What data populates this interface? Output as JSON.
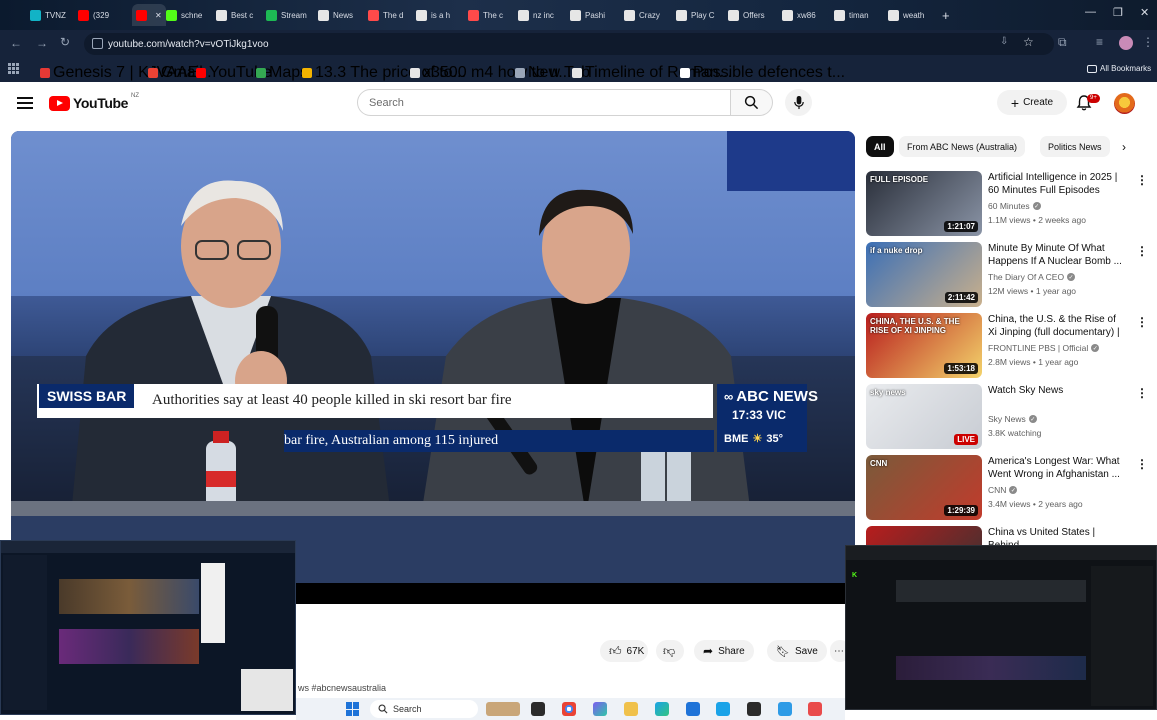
{
  "browser": {
    "tabs": [
      {
        "label": "TVNZ",
        "color": "#12b3c6",
        "active": false
      },
      {
        "label": "(329",
        "color": "#ff0000",
        "active": false
      },
      {
        "label": "",
        "color": "#ff0000",
        "active": true
      },
      {
        "label": "schne",
        "color": "#53fc18",
        "active": false
      },
      {
        "label": "Best c",
        "color": "#e6e6e6",
        "active": false
      },
      {
        "label": "Stream",
        "color": "#1db954",
        "active": false
      },
      {
        "label": "News",
        "color": "#e6e6e6",
        "active": false
      },
      {
        "label": "The d",
        "color": "#ff4a4a",
        "active": false
      },
      {
        "label": "is a h",
        "color": "#e6e6e6",
        "active": false
      },
      {
        "label": "The c",
        "color": "#ff4a4a",
        "active": false
      },
      {
        "label": "nz inc",
        "color": "#e6e6e6",
        "active": false
      },
      {
        "label": "Pashi",
        "color": "#e6e6e6",
        "active": false
      },
      {
        "label": "Crazy",
        "color": "#e6e6e6",
        "active": false
      },
      {
        "label": "Play C",
        "color": "#e6e6e6",
        "active": false
      },
      {
        "label": "Offers",
        "color": "#e6e6e6",
        "active": false
      },
      {
        "label": "xw86",
        "color": "#e6e6e6",
        "active": false
      },
      {
        "label": "timan",
        "color": "#e6e6e6",
        "active": false
      },
      {
        "label": "weath",
        "color": "#e6e6e6",
        "active": false
      }
    ],
    "new_tab": "+",
    "url": "youtube.com/watch?v=vOTiJkg1voo",
    "bookmarks": [
      {
        "label": "Genesis 7 | KJVAAE...",
        "color": "#e53935"
      },
      {
        "label": "Gmail",
        "color": "#ea4335"
      },
      {
        "label": "YouTube",
        "color": "#ff0000"
      },
      {
        "label": "Maps",
        "color": "#34a853"
      },
      {
        "label": "13.3 The price of to...",
        "color": "#f4b400"
      },
      {
        "label": "x3500 m4 how to u...",
        "color": "#e6e6e6"
      },
      {
        "label": "New Tab",
        "color": "#9aa6b8"
      },
      {
        "label": "Timeline of Roman...",
        "color": "#e6e6e6"
      },
      {
        "label": "Possible defences t...",
        "color": "#ffffff"
      }
    ],
    "all_bookmarks": "All Bookmarks"
  },
  "youtube": {
    "logo_text": "YouTube",
    "region": "NZ",
    "search_placeholder": "Search",
    "create_label": "Create",
    "notifications": "9+",
    "filter_chips": [
      "All",
      "From ABC News (Australia)",
      "Politics News"
    ]
  },
  "video": {
    "lower_third_tag": "SWISS BAR",
    "headline": "Authorities say at least 40 people killed in ski resort bar fire",
    "ticker": "bar fire, Australian among 115 injured",
    "brand": "ABC NEWS",
    "time": "17:33 VIC",
    "weather_city": "BME",
    "weather_temp": "35°",
    "likes": "67K",
    "share_label": "Share",
    "save_label": "Save",
    "hashtags": "ws #abcnewsaustralia"
  },
  "recommendations": [
    {
      "title": "Artificial Intelligence in 2025 | 60 Minutes Full Episodes",
      "channel": "60 Minutes",
      "meta": "1.1M views • 2 weeks ago",
      "badge": "1:21:07",
      "live": false,
      "thumb_label": "FULL EPISODE",
      "colors": [
        "#2a2f3a",
        "#8a94a6"
      ]
    },
    {
      "title": "Minute By Minute Of What Happens If A Nuclear Bomb ...",
      "channel": "The Diary Of A CEO",
      "meta": "12M views • 1 year ago",
      "badge": "2:11:42",
      "live": false,
      "thumb_label": "if a nuke drop",
      "colors": [
        "#3b6fb6",
        "#c9b08c"
      ]
    },
    {
      "title": "China, the U.S. & the Rise of Xi Jinping (full documentary) | ...",
      "channel": "FRONTLINE PBS | Official",
      "meta": "2.8M views • 1 year ago",
      "badge": "1:53:18",
      "live": false,
      "thumb_label": "CHINA, THE U.S. & THE RISE OF XI JINPING",
      "colors": [
        "#b81d1d",
        "#f3d36b"
      ]
    },
    {
      "title": "Watch Sky News",
      "channel": "Sky News",
      "meta": "3.8K watching",
      "badge": "LIVE",
      "live": true,
      "thumb_label": "sky news",
      "colors": [
        "#e9ebee",
        "#c8ccd3"
      ]
    },
    {
      "title": "America's Longest War: What Went Wrong in Afghanistan ...",
      "channel": "CNN",
      "meta": "3.4M views • 2 years ago",
      "badge": "1:29:39",
      "live": false,
      "thumb_label": "CNN",
      "colors": [
        "#7a5a3a",
        "#c23b2c"
      ]
    },
    {
      "title": "China vs United States | Behind",
      "channel": "",
      "meta": "",
      "badge": "",
      "live": false,
      "thumb_label": "",
      "colors": [
        "#b81d1d",
        "#333333"
      ]
    }
  ],
  "taskbar": {
    "search_placeholder": "Search"
  },
  "icons": {
    "back": "back-arrow-icon",
    "forward": "forward-arrow-icon",
    "reload": "reload-icon",
    "search": "search-icon",
    "mic": "microphone-icon",
    "bell": "bell-icon",
    "like": "thumbs-up-icon",
    "dislike": "thumbs-down-icon",
    "share": "share-icon",
    "save": "bookmark-icon"
  }
}
